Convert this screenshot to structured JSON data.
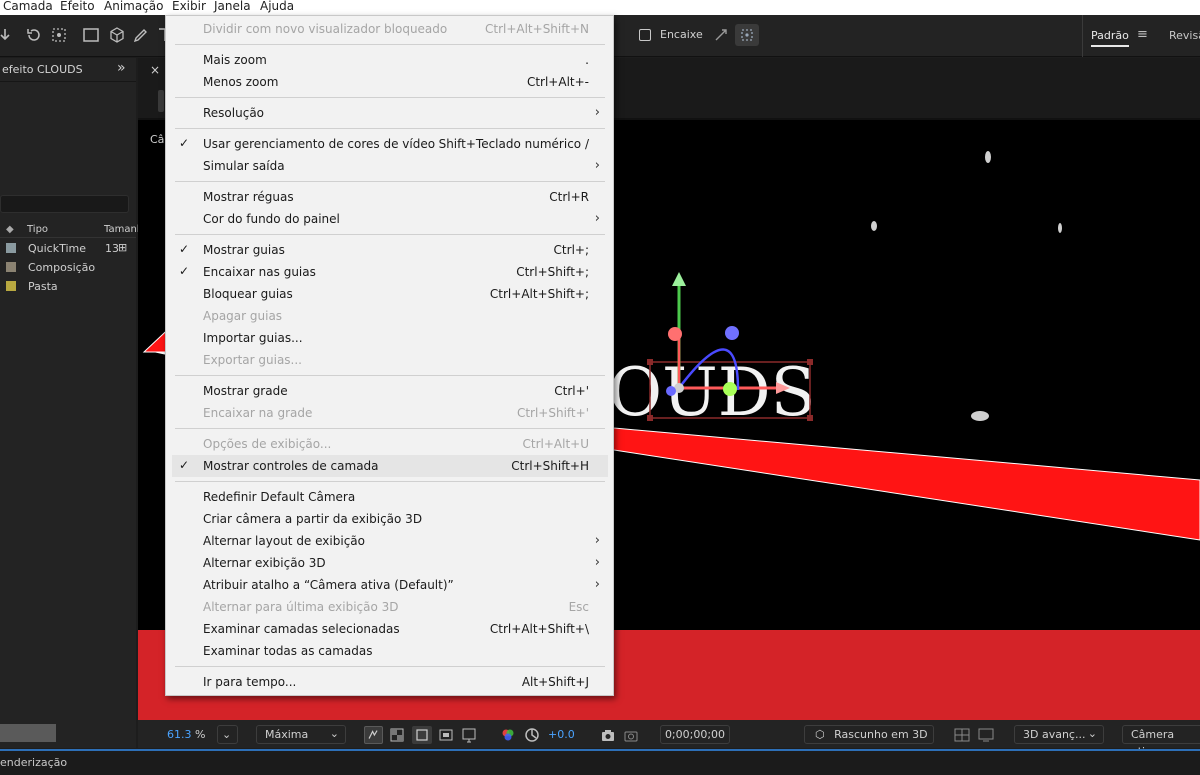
{
  "menubar": {
    "items": [
      "Camada",
      "Efeito",
      "Animação",
      "Exibir",
      "Janela",
      "Ajuda"
    ]
  },
  "toolbar": {
    "snap_label": "Encaixe",
    "workspace_active": "Padrão",
    "workspace_next": "Revisã"
  },
  "project": {
    "effect_title": "efeito CLOUDS",
    "col_type": "Tipo",
    "col_size": "Tamanl",
    "items": [
      {
        "label": "QuickTime",
        "size": "13",
        "color": "#8a9aa0"
      },
      {
        "label": "Composição",
        "size": "",
        "color": "#8b8372"
      },
      {
        "label": "Pasta",
        "size": "",
        "color": "#b8a840"
      }
    ]
  },
  "comp": {
    "close_x": "×",
    "camera_label": "Câm",
    "title_text": "OUDS"
  },
  "controls": {
    "zoom": "61.3",
    "zoom_unit": "%",
    "resolution": "Máxima",
    "exposure": "+0.0",
    "timecode": "0;00;00;00",
    "renderer": "Rascunho em 3D",
    "view_3d": "3D avanç...",
    "camera": "Câmera ativa..."
  },
  "status": {
    "text": "enderização"
  },
  "menu": {
    "items": [
      {
        "label": "Dividir com novo visualizador bloqueado",
        "shortcut": "Ctrl+Alt+Shift+N",
        "disabled": true
      },
      {
        "label": "Mais zoom",
        "shortcut": "."
      },
      {
        "label": "Menos zoom",
        "shortcut": "Ctrl+Alt+-"
      },
      {
        "label": "Resolução",
        "submenu": true
      },
      {
        "label": "Usar gerenciamento de cores de vídeo",
        "shortcut": "Shift+Teclado numérico /",
        "checked": true
      },
      {
        "label": "Simular saída",
        "submenu": true
      },
      {
        "label": "Mostrar réguas",
        "shortcut": "Ctrl+R"
      },
      {
        "label": "Cor do fundo do painel",
        "submenu": true
      },
      {
        "label": "Mostrar guias",
        "shortcut": "Ctrl+;",
        "checked": true
      },
      {
        "label": "Encaixar nas guias",
        "shortcut": "Ctrl+Shift+;",
        "checked": true
      },
      {
        "label": "Bloquear guias",
        "shortcut": "Ctrl+Alt+Shift+;"
      },
      {
        "label": "Apagar guias",
        "disabled": true
      },
      {
        "label": "Importar guias..."
      },
      {
        "label": "Exportar guias...",
        "disabled": true
      },
      {
        "label": "Mostrar grade",
        "shortcut": "Ctrl+'"
      },
      {
        "label": "Encaixar na grade",
        "shortcut": "Ctrl+Shift+'",
        "disabled": true
      },
      {
        "label": "Opções de exibição...",
        "shortcut": "Ctrl+Alt+U",
        "disabled": true
      },
      {
        "label": "Mostrar controles de camada",
        "shortcut": "Ctrl+Shift+H",
        "checked": true,
        "highlight": true
      },
      {
        "label": "Redefinir Default Câmera"
      },
      {
        "label": "Criar câmera a partir da exibição 3D"
      },
      {
        "label": "Alternar layout de exibição",
        "submenu": true
      },
      {
        "label": "Alternar exibição 3D",
        "submenu": true
      },
      {
        "label": "Atribuir atalho a “Câmera ativa (Default)”",
        "submenu": true
      },
      {
        "label": "Alternar para última exibição 3D",
        "shortcut": "Esc",
        "disabled": true
      },
      {
        "label": "Examinar camadas selecionadas",
        "shortcut": "Ctrl+Alt+Shift+\\"
      },
      {
        "label": "Examinar todas as camadas"
      },
      {
        "label": "Ir para tempo...",
        "shortcut": "Alt+Shift+J"
      }
    ],
    "check_glyph": "✓",
    "arrow_glyph": "›"
  },
  "colors": {
    "accent_blue": "#2d6fb7",
    "comp_red": "#d42328",
    "menu_bg": "#f2f2f2"
  }
}
